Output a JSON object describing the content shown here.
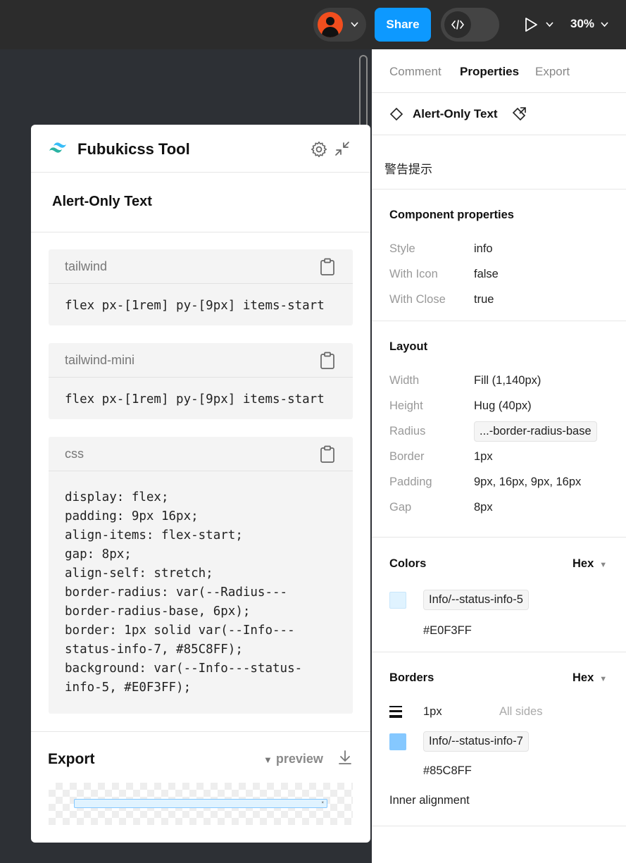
{
  "toolbar": {
    "share_label": "Share",
    "zoom": "30%",
    "avatar_color": "#f24e1e",
    "share_color": "#0d99ff"
  },
  "plugin": {
    "title": "Fubukicss Tool",
    "component_name": "Alert-Only Text",
    "blocks": [
      {
        "label": "tailwind",
        "code": "flex px-[1rem] py-[9px] items-start"
      },
      {
        "label": "tailwind-mini",
        "code": "flex px-[1rem] py-[9px] items-start"
      },
      {
        "label": "css",
        "code": "display: flex;\npadding: 9px 16px;\nalign-items: flex-start;\ngap: 8px;\nalign-self: stretch;\nborder-radius: var(--Radius---\nborder-radius-base, 6px);\nborder: 1px solid var(--Info---\nstatus-info-7, #85C8FF);\nbackground: var(--Info---status-\ninfo-5, #E0F3FF);"
      }
    ],
    "export": {
      "title": "Export",
      "preview_label": "preview"
    }
  },
  "properties": {
    "tabs": [
      "Comment",
      "Properties",
      "Export"
    ],
    "active_tab": "Properties",
    "component": {
      "name": "Alert-Only Text",
      "description": "警告提示"
    },
    "component_properties": {
      "title": "Component properties",
      "rows": [
        {
          "label": "Style",
          "value": "info"
        },
        {
          "label": "With Icon",
          "value": "false"
        },
        {
          "label": "With Close",
          "value": "true"
        }
      ]
    },
    "layout": {
      "title": "Layout",
      "rows": [
        {
          "label": "Width",
          "value": "Fill (1,140px)"
        },
        {
          "label": "Height",
          "value": "Hug (40px)"
        },
        {
          "label": "Radius",
          "value": "...-border-radius-base"
        },
        {
          "label": "Border",
          "value": "1px"
        },
        {
          "label": "Padding",
          "value": "9px, 16px, 9px, 16px"
        },
        {
          "label": "Gap",
          "value": "8px"
        }
      ]
    },
    "colors": {
      "title": "Colors",
      "format": "Hex",
      "items": [
        {
          "token": "Info/--status-info-5",
          "hex": "#E0F3FF"
        }
      ]
    },
    "borders": {
      "title": "Borders",
      "format": "Hex",
      "weight": "1px",
      "sides": "All sides",
      "items": [
        {
          "token": "Info/--status-info-7",
          "hex": "#85C8FF"
        }
      ]
    },
    "inner_alignment": "Inner alignment"
  }
}
